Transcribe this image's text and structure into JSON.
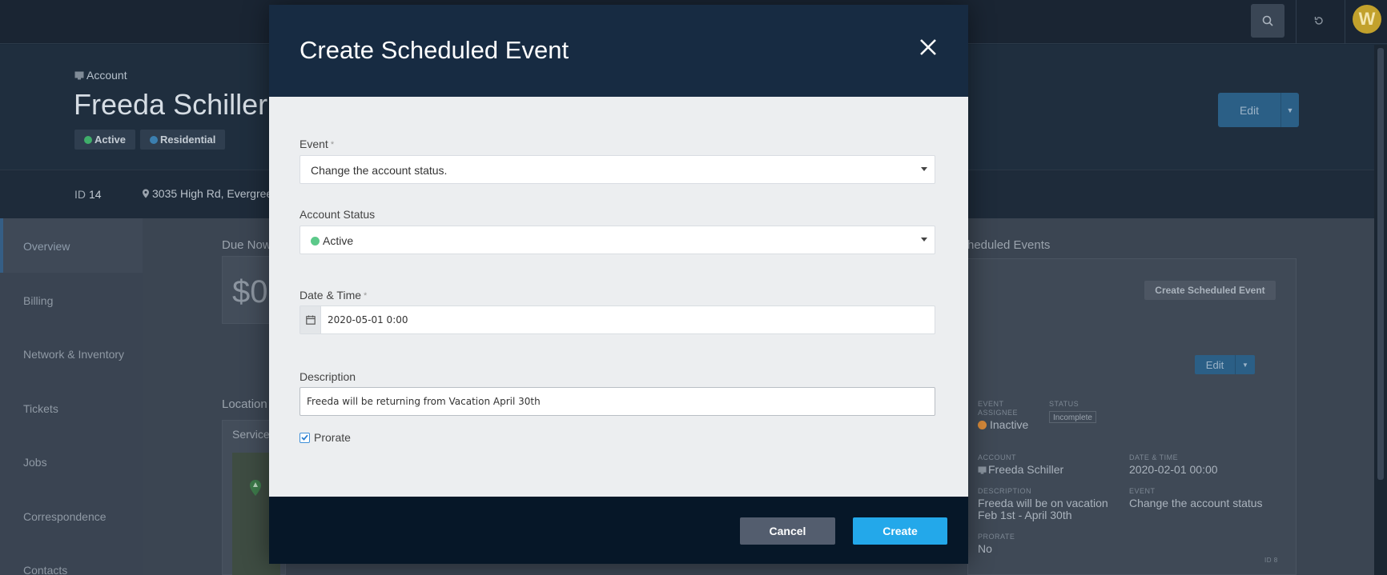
{
  "app": {
    "avatar_initial": "W",
    "account": {
      "crumb": "Account",
      "name": "Freeda Schiller",
      "badges": [
        {
          "label": "Active",
          "color": "#3fae6a"
        },
        {
          "label": "Residential",
          "color": "#3b7fb0"
        }
      ],
      "edit_label": "Edit",
      "id_label": "ID",
      "id_value": "14",
      "address": "3035 High Rd, Evergree"
    },
    "sidebar": {
      "items": [
        {
          "label": "Overview"
        },
        {
          "label": "Billing"
        },
        {
          "label": "Network & Inventory"
        },
        {
          "label": "Tickets"
        },
        {
          "label": "Jobs"
        },
        {
          "label": "Correspondence"
        },
        {
          "label": "Contacts"
        }
      ]
    },
    "main": {
      "due_now_label": "Due Now",
      "due_amount": "$0",
      "location_label": "Location",
      "service_label": "Service",
      "scheduled_events_label": "heduled Events",
      "create_scheduled_event_label": "Create Scheduled Event",
      "card_edit_label": "Edit",
      "event_assignee_label": "EVENT ASSIGNEE",
      "event_assignee_value": "Inactive",
      "status_label": "STATUS",
      "status_value": "Incomplete",
      "account_label": "ACCOUNT",
      "account_value": "Freeda Schiller",
      "date_time_label": "DATE & TIME",
      "date_time_value": "2020-02-01 00:00",
      "description_label": "DESCRIPTION",
      "description_value": "Freeda will be on vacation Feb 1st - April 30th",
      "event_label": "EVENT",
      "event_value": "Change the account status",
      "prorate_label": "PRORATE",
      "prorate_value": "No",
      "id_small": "ID 8"
    }
  },
  "modal": {
    "title": "Create Scheduled Event",
    "fields": {
      "event": {
        "label": "Event",
        "required_mark": "*",
        "value": "Change the account status."
      },
      "account_status": {
        "label": "Account Status",
        "value": "Active",
        "dot_color": "#5cc98a"
      },
      "date_time": {
        "label": "Date & Time",
        "required_mark": "*",
        "value": "2020-05-01 0:00"
      },
      "description": {
        "label": "Description",
        "value": "Freeda will be returning from Vacation April 30th"
      },
      "prorate": {
        "label": "Prorate",
        "checked": true
      }
    },
    "buttons": {
      "cancel": "Cancel",
      "create": "Create"
    }
  },
  "colors": {
    "modal_header": "#172b42",
    "modal_footer": "#061728",
    "create_button": "#23a8ea",
    "cancel_button": "#535d6e"
  }
}
